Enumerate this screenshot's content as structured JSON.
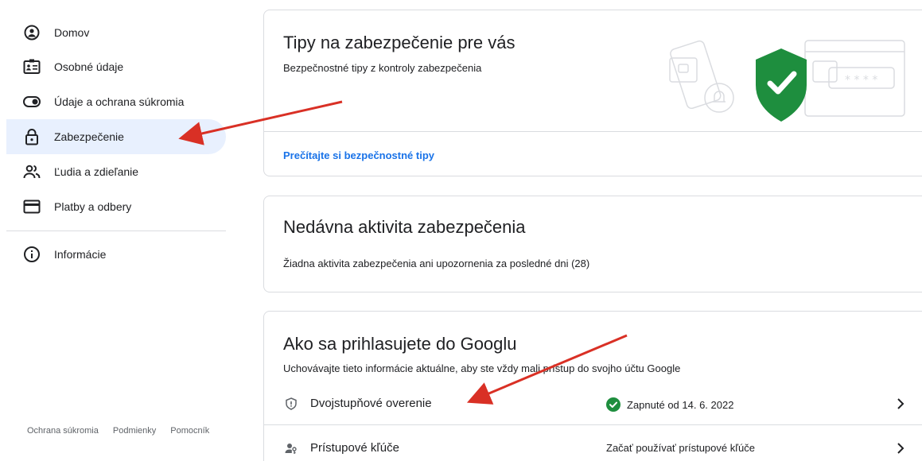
{
  "sidebar": {
    "items": [
      {
        "label": "Domov",
        "icon": "home-icon"
      },
      {
        "label": "Osobné údaje",
        "icon": "id-card-icon"
      },
      {
        "label": "Údaje a ochrana súkromia",
        "icon": "toggle-icon"
      },
      {
        "label": "Zabezpečenie",
        "icon": "lock-icon"
      },
      {
        "label": "Ľudia a zdieľanie",
        "icon": "people-icon"
      },
      {
        "label": "Platby a odbery",
        "icon": "credit-card-icon"
      },
      {
        "label": "Informácie",
        "icon": "info-icon"
      }
    ],
    "active_index": 3,
    "footer": [
      "Ochrana súkromia",
      "Podmienky",
      "Pomocník"
    ]
  },
  "cards": {
    "tips": {
      "title": "Tipy na zabezpečenie pre vás",
      "subtitle": "Bezpečnostné tipy z kontroly zabezpečenia",
      "link": "Prečítajte si bezpečnostné tipy"
    },
    "activity": {
      "title": "Nedávna aktivita zabezpečenia",
      "subtitle": "Žiadna aktivita zabezpečenia ani upozornenia za posledné dni (28)"
    },
    "signin": {
      "title": "Ako sa prihlasujete do Googlu",
      "subtitle": "Uchovávajte tieto informácie aktuálne, aby ste vždy mali prístup do svojho účtu Google",
      "rows": [
        {
          "label": "Dvojstupňové overenie",
          "status": "Zapnuté od 14. 6. 2022",
          "icon": "shield-icon",
          "status_icon": "check-circle-icon"
        },
        {
          "label": "Prístupové kľúče",
          "status": "Začať používať prístupové kľúče",
          "icon": "passkey-icon"
        }
      ]
    }
  },
  "colors": {
    "accent": "#1a73e8",
    "active_bg": "#e8f0fe",
    "shield_green": "#1e8e3e",
    "annotation_red": "#d93025"
  }
}
